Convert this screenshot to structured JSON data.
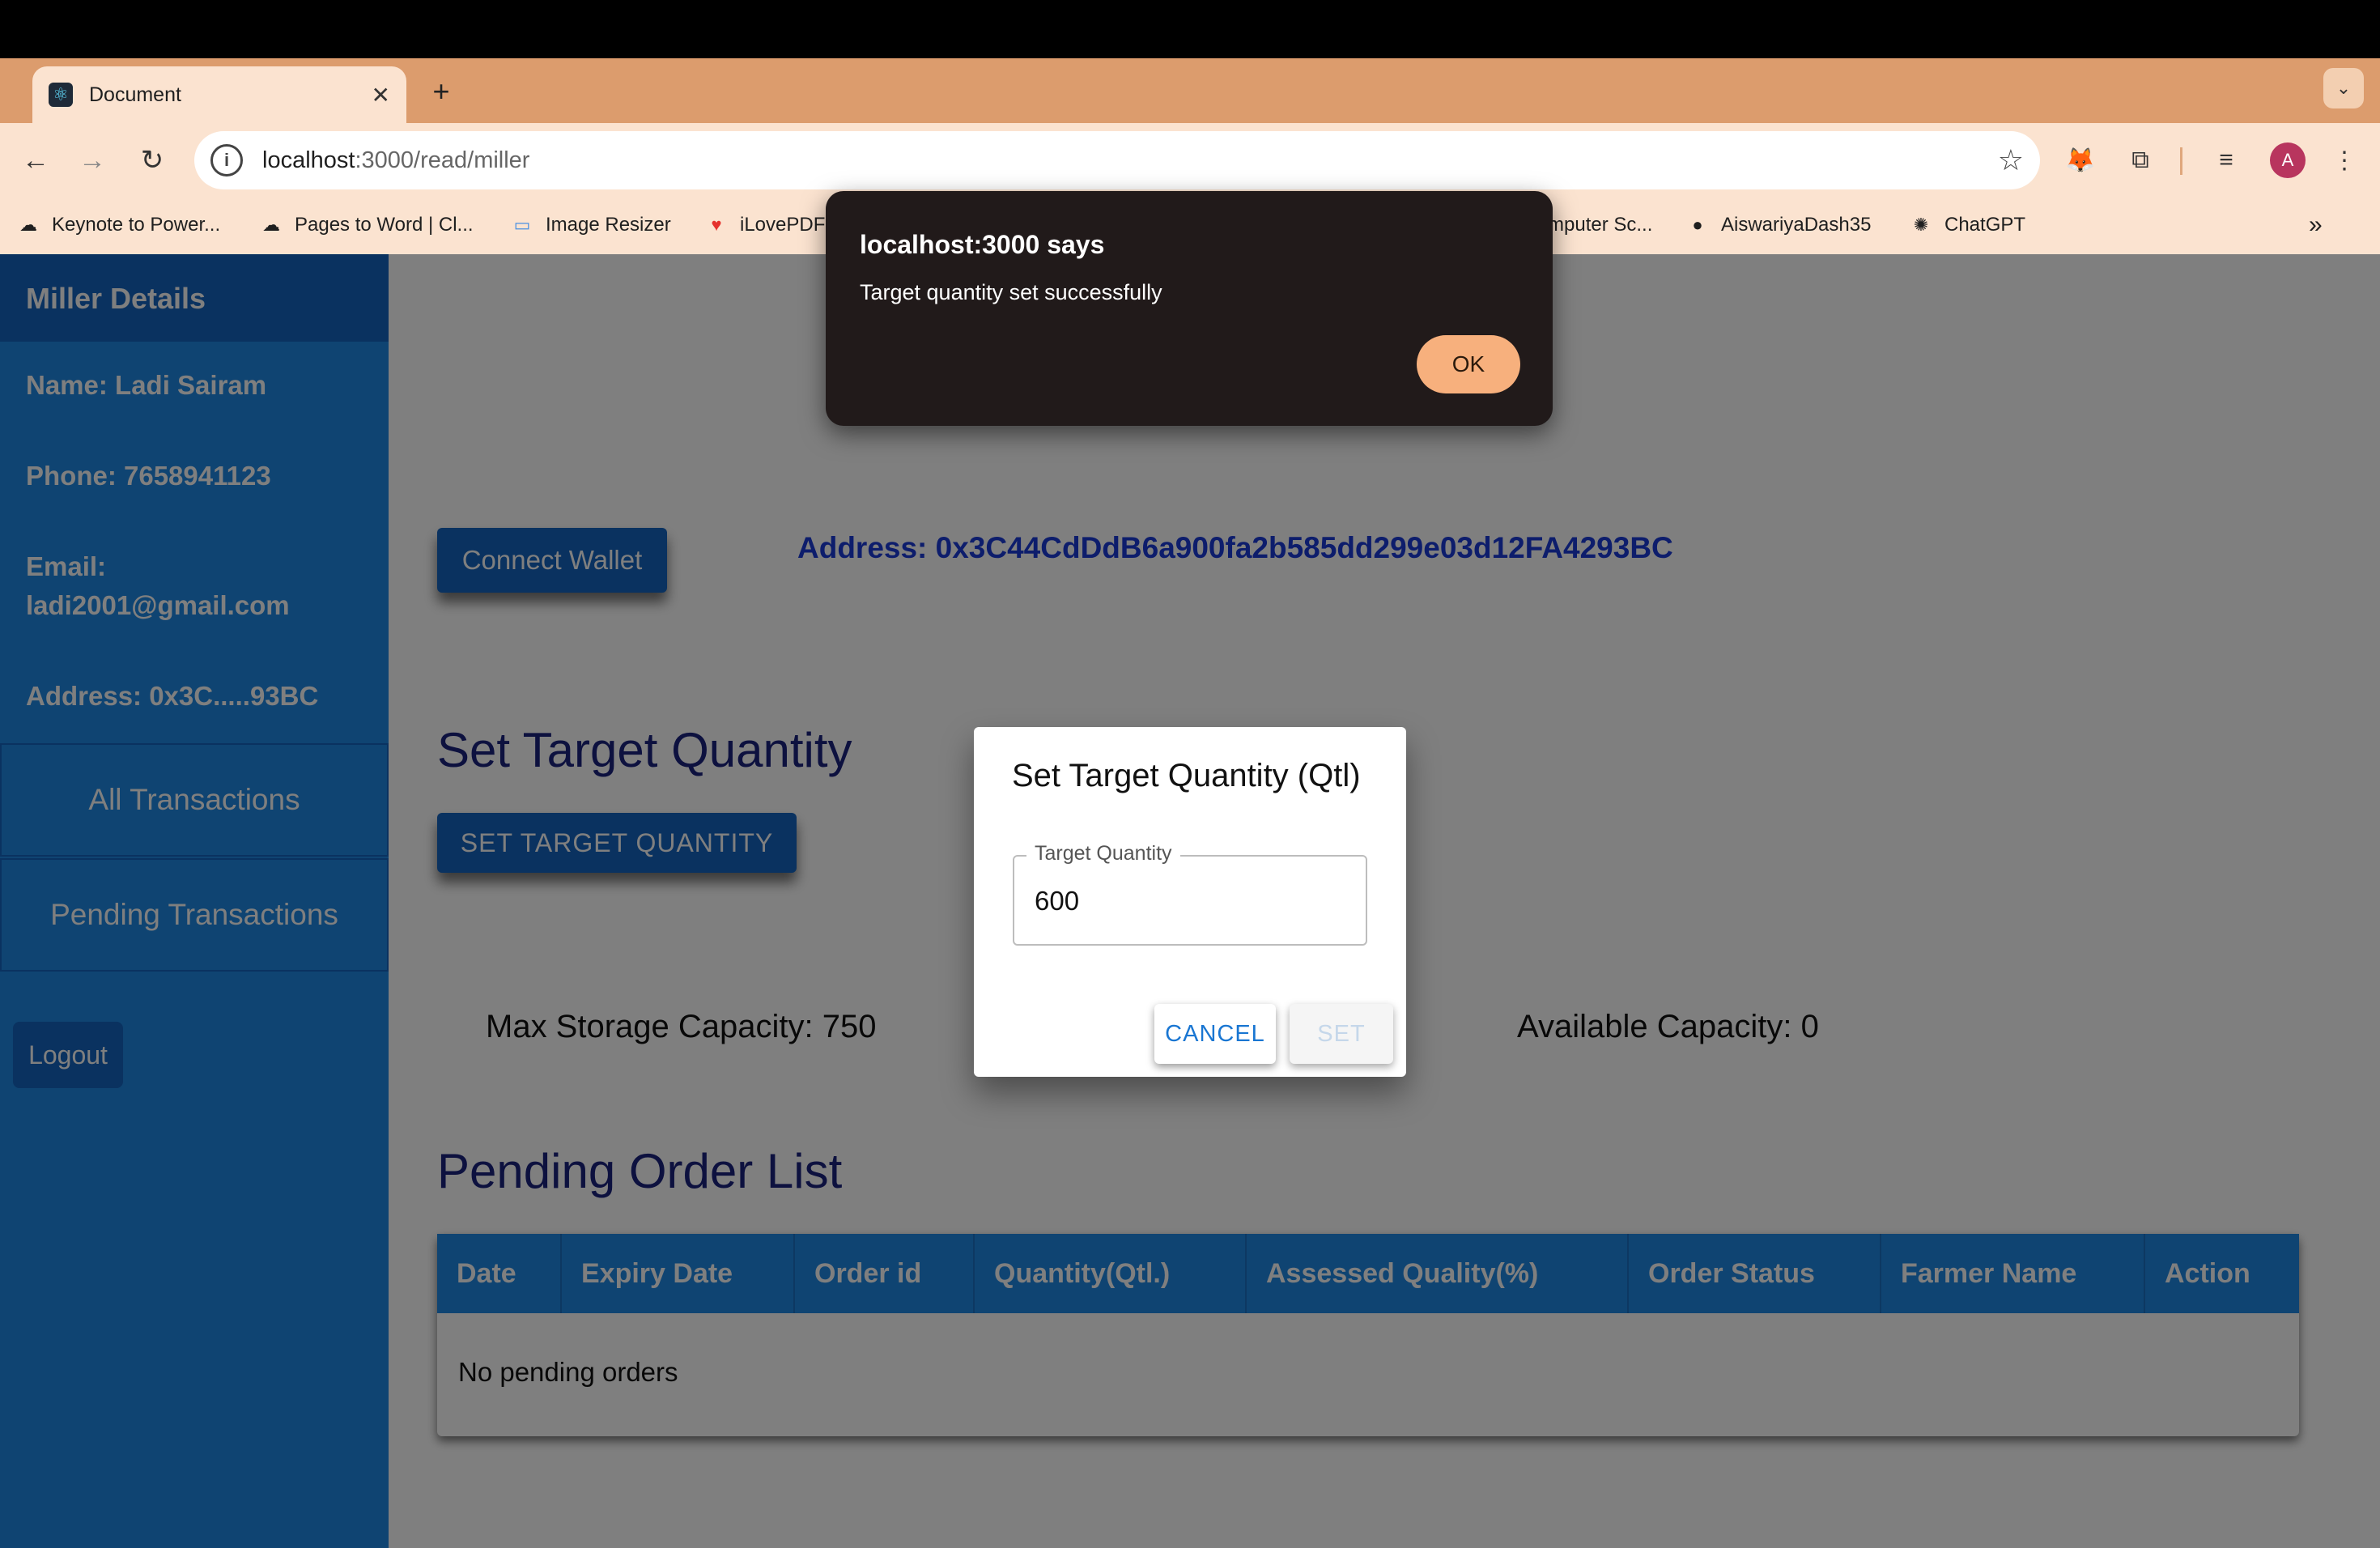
{
  "browser": {
    "tab_title": "Document",
    "new_tab": "+",
    "url_host": "localhost",
    "url_path": ":3000/read/miller",
    "bookmarks": [
      {
        "label": "Keynote to Power...",
        "icon": "cloud-icon"
      },
      {
        "label": "Pages to Word | Cl...",
        "icon": "cloud-icon"
      },
      {
        "label": "Image Resizer",
        "icon": "image-icon"
      },
      {
        "label": "iLovePDF",
        "icon": "heart-icon"
      },
      {
        "label": "mputer Sc...",
        "icon": "bookmark-icon"
      },
      {
        "label": "AiswariyaDash35",
        "icon": "github-icon"
      },
      {
        "label": "ChatGPT",
        "icon": "chatgpt-icon"
      }
    ],
    "profile_initial": "A"
  },
  "sidebar": {
    "header": "Miller Details",
    "name": "Name: Ladi Sairam",
    "phone": "Phone: 7658941123",
    "email_label": "Email:",
    "email_value": "ladi2001@gmail.com",
    "address": "Address: 0x3C.....93BC",
    "nav": [
      "All Transactions",
      "Pending Transactions"
    ],
    "logout": "Logout"
  },
  "main": {
    "connect_wallet": "Connect Wallet",
    "address": "Address: 0x3C44CdDdB6a900fa2b585dd299e03d12FA4293BC",
    "set_target_heading": "Set Target Quantity",
    "set_target_button": "SET TARGET QUANTITY",
    "max_storage": "Max Storage Capacity: 750",
    "available": "Available Capacity: 0",
    "pending_heading": "Pending Order List",
    "table_headers": [
      "Date",
      "Expiry Date",
      "Order id",
      "Quantity(Qtl.)",
      "Assessed Quality(%)",
      "Order Status",
      "Farmer Name",
      "Action"
    ],
    "empty_message": "No pending orders"
  },
  "dialog": {
    "title": "Set Target Quantity (Qtl)",
    "field_label": "Target Quantity",
    "field_value": "600",
    "cancel": "CANCEL",
    "set": "SET"
  },
  "alert": {
    "title": "localhost:3000 says",
    "message": "Target quantity set successfully",
    "ok": "OK"
  },
  "colors": {
    "sidebar": "#1e88e5",
    "sidebar_header": "#1565c0",
    "primary": "#1565c0",
    "heading": "#1a237e",
    "address": "#1a3bd8",
    "tabstrip": "#dc9c6d",
    "toolbar": "#fbe3d0",
    "alert_bg": "#211a1a",
    "alert_ok": "#f7b07d"
  }
}
